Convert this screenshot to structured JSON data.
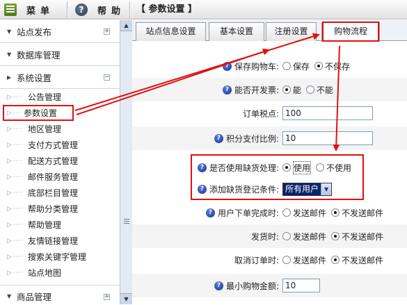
{
  "topbar": {
    "menu_label": "菜单",
    "help_label": "帮助",
    "page_title": "【 参数设置 】"
  },
  "sidebar": {
    "sections": [
      {
        "label": "站点发布",
        "toggle": "+"
      },
      {
        "label": "数据库管理",
        "toggle": ""
      },
      {
        "label": "系统设置",
        "toggle": "−"
      }
    ],
    "items": [
      {
        "label": "公告管理"
      },
      {
        "label": "参数设置"
      },
      {
        "label": "地区管理"
      },
      {
        "label": "支付方式管理"
      },
      {
        "label": "配送方式管理"
      },
      {
        "label": "邮件服务管理"
      },
      {
        "label": "底部栏目管理"
      },
      {
        "label": "帮助分类管理"
      },
      {
        "label": "帮助管理"
      },
      {
        "label": "友情链接管理"
      },
      {
        "label": "搜索关键字管理"
      },
      {
        "label": "站点地图"
      }
    ],
    "bottom_section": {
      "label": "商品管理",
      "toggle": "+"
    }
  },
  "tabs": [
    {
      "label": "站点信息设置"
    },
    {
      "label": "基本设置"
    },
    {
      "label": "注册设置"
    },
    {
      "label": "购物流程"
    }
  ],
  "form": {
    "rows": [
      {
        "label": "保存购物车:",
        "options": [
          "保存",
          "不保存"
        ],
        "selected": 1
      },
      {
        "label": "能否开发票:",
        "options": [
          "能",
          "不能"
        ],
        "selected": 0
      },
      {
        "label": "订单税点:",
        "value": "100"
      },
      {
        "label": "积分支付比例:",
        "value": "10"
      },
      {
        "label": "是否使用缺货处理:",
        "options": [
          "使用",
          "不使用"
        ],
        "selected": 0
      },
      {
        "label": "添加缺货登记条件:",
        "select_value": "所有用户"
      },
      {
        "label": "用户下单完成时:",
        "options": [
          "发送邮件",
          "不发送邮件"
        ],
        "selected": 1
      },
      {
        "label": "发货时:",
        "options": [
          "发送邮件",
          "不发送邮件"
        ],
        "selected": 1
      },
      {
        "label": "取消订单时:",
        "options": [
          "发送邮件",
          "不发送邮件"
        ],
        "selected": 1
      },
      {
        "label": "最小购物金额:",
        "value": "10"
      }
    ]
  },
  "colors": {
    "annotation": "#e01010",
    "help_icon": "#1a2f8c",
    "tab_border": "#8f9baa"
  }
}
